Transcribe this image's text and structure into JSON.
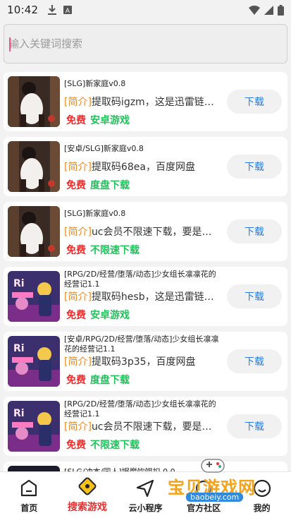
{
  "status_bar": {
    "time": "10:42"
  },
  "search": {
    "placeholder": "输入关键词搜索",
    "value": ""
  },
  "items": [
    {
      "title": "[SLG]新家庭v0.8",
      "intro_tag": "[简介]",
      "intro_text": "提取码igzm，这是迅雷链…",
      "free": "免费",
      "kind": "安卓游戏",
      "button": "下载",
      "thumb": "girl"
    },
    {
      "title": "[安卓/SLG]新家庭v0.8",
      "intro_tag": "[简介]",
      "intro_text": "提取码68ea，百度网盘",
      "free": "免费",
      "kind": "度盘下载",
      "button": "下载",
      "thumb": "girl"
    },
    {
      "title": "[SLG]新家庭v0.8",
      "intro_tag": "[简介]",
      "intro_text": "uc会员不限速下载，要是…",
      "free": "免费",
      "kind": "不限速下载",
      "button": "下载",
      "thumb": "girl"
    },
    {
      "title": "[RPG/2D/经营/堕落/动态]少女组长凛凛花的经营记1.1",
      "intro_tag": "[简介]",
      "intro_text": "提取码hesb，这是迅雷链…",
      "free": "免费",
      "kind": "安卓游戏",
      "button": "下载",
      "thumb": "anime"
    },
    {
      "title": "[安卓/RPG/2D/经营/堕落/动态]少女组长凛凛花的经营记1.1",
      "intro_tag": "[简介]",
      "intro_text": "提取码3p35，百度网盘",
      "free": "免费",
      "kind": "度盘下载",
      "button": "下载",
      "thumb": "anime"
    },
    {
      "title": "[RPG/2D/经营/堕落/动态]少女组长凛凛花的经营记1.1",
      "intro_tag": "[简介]",
      "intro_text": "uc会员不限速下载，要是…",
      "free": "免费",
      "kind": "不限速下载",
      "button": "下载",
      "thumb": "anime"
    }
  ],
  "partial_item": {
    "title": "[SLG/冲本/同人]据魔饮饵扣 0.0"
  },
  "bottom_nav": [
    {
      "label": "首页",
      "icon": "home-icon"
    },
    {
      "label": "搜索游戏",
      "icon": "search-game-icon",
      "active": true
    },
    {
      "label": "云小程序",
      "icon": "send-icon"
    },
    {
      "label": "官方社区",
      "icon": "community-icon"
    },
    {
      "label": "我的",
      "icon": "profile-icon"
    }
  ],
  "watermark": {
    "text": "宝贝游戏网",
    "url": "baobeiy.com"
  },
  "colors": {
    "free": "#ee2a2a",
    "kind": "#1ec35a",
    "tag": "#f08a22",
    "button_text": "#2b7be0",
    "active_nav": "#e82f2f"
  }
}
